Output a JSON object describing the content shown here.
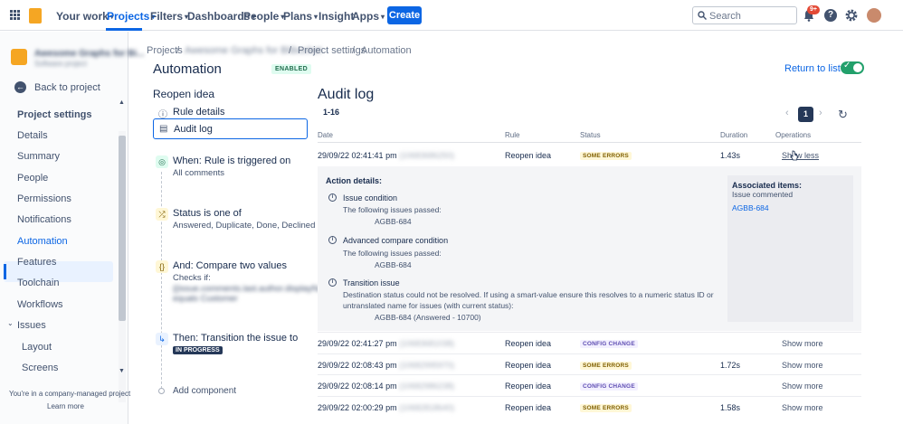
{
  "topnav": {
    "your_work": "Your work",
    "projects": "Projects",
    "filters": "Filters",
    "dashboards": "Dashboards",
    "people": "People",
    "plans": "Plans",
    "insight": "Insight",
    "apps": "Apps",
    "create": "Create",
    "search_placeholder": "Search",
    "notif_count": "9+"
  },
  "sidebar": {
    "project_name": "Awesome Graphs for Bi...",
    "project_type": "Software project",
    "back": "Back to project",
    "section": "Project settings",
    "items": [
      "Details",
      "Summary",
      "People",
      "Permissions",
      "Notifications",
      "Automation",
      "Features",
      "Toolchain",
      "Workflows",
      "Issues",
      "Layout",
      "Screens"
    ],
    "footer1": "You're in a company-managed project",
    "footer2": "Learn more"
  },
  "breadcrumb": {
    "projects": "Projects",
    "project": "Awesome Graphs for Bitbucket",
    "settings": "Project settings",
    "automation": "Automation"
  },
  "header": {
    "title": "Automation",
    "badge": "ENABLED",
    "return": "Return to list"
  },
  "rule": {
    "name": "Reopen idea",
    "nav": [
      "Rule details",
      "Audit log"
    ],
    "steps": [
      {
        "title": "When: Rule is triggered on",
        "sub": "All comments"
      },
      {
        "title": "Status is one of",
        "sub": "Answered, Duplicate, Done, Declined"
      },
      {
        "title": "And: Compare two values",
        "sub": "Checks if:",
        "sub2": "{{issue.comments.last.author.displayName}} equals Customer"
      },
      {
        "title": "Then: Transition the issue to",
        "badge": "IN PROGRESS"
      }
    ],
    "add": "Add component"
  },
  "audit": {
    "title": "Audit log",
    "range": "1-16",
    "page": "1",
    "columns": [
      "Date",
      "Rule",
      "Status",
      "Duration",
      "Operations"
    ],
    "rows": [
      {
        "date": "29/09/22 02:41:41 pm",
        "id": "(10683686250)",
        "rule": "Reopen idea",
        "status": "SOME ERRORS",
        "kind": "err",
        "duration": "1.43s",
        "op": "Show less"
      },
      {
        "date": "29/09/22 02:41:27 pm",
        "id": "(10683681038)",
        "rule": "Reopen idea",
        "status": "CONFIG CHANGE",
        "kind": "cfg",
        "duration": "",
        "op": "Show more"
      },
      {
        "date": "29/09/22 02:08:43 pm",
        "id": "(10682995970)",
        "rule": "Reopen idea",
        "status": "SOME ERRORS",
        "kind": "err",
        "duration": "1.72s",
        "op": "Show more"
      },
      {
        "date": "29/09/22 02:08:14 pm",
        "id": "(10682986238)",
        "rule": "Reopen idea",
        "status": "CONFIG CHANGE",
        "kind": "cfg",
        "duration": "",
        "op": "Show more"
      },
      {
        "date": "29/09/22 02:00:29 pm",
        "id": "(10682818640)",
        "rule": "Reopen idea",
        "status": "SOME ERRORS",
        "kind": "err",
        "duration": "1.58s",
        "op": "Show more"
      }
    ],
    "details": {
      "heading": "Action details:",
      "items": [
        {
          "title": "Issue condition",
          "line1": "The following issues passed:",
          "line2": "AGBB-684"
        },
        {
          "title": "Advanced compare condition",
          "line1": "The following issues passed:",
          "line2": "AGBB-684"
        },
        {
          "title": "Transition issue",
          "line1": "Destination status could not be resolved. If using a smart-value ensure this resolves to a numeric status ID or",
          "line1b": "untranslated name for issues (with current status):",
          "line2": "AGBB-684 (Answered - 10700)"
        }
      ],
      "assoc_title": "Associated items:",
      "assoc_sub": "Issue commented",
      "assoc_link": "AGBB-684"
    }
  }
}
